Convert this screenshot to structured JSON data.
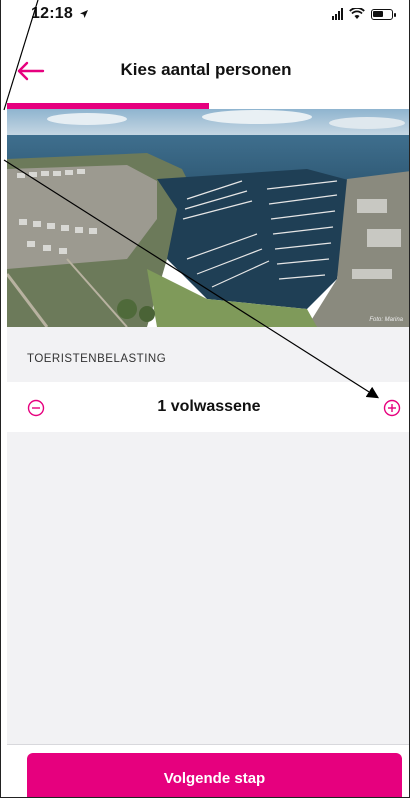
{
  "status_bar": {
    "time": "12:18",
    "icons": [
      "location-arrow-icon",
      "signal-icon",
      "wifi-icon",
      "battery-icon"
    ]
  },
  "header": {
    "title": "Kies aantal personen",
    "back_icon": "arrow-left-icon"
  },
  "progress": {
    "fraction": 0.5
  },
  "hero": {
    "credit": "Foto: Marina"
  },
  "section": {
    "label": "TOERISTENBELASTING"
  },
  "stepper": {
    "value_label": "1 volwassene",
    "minus_icon": "minus-circle-icon",
    "plus_icon": "plus-circle-icon"
  },
  "footer": {
    "next_label": "Volgende stap"
  },
  "colors": {
    "accent": "#e6007e",
    "panel": "#f2f2f4",
    "text": "#111111"
  }
}
